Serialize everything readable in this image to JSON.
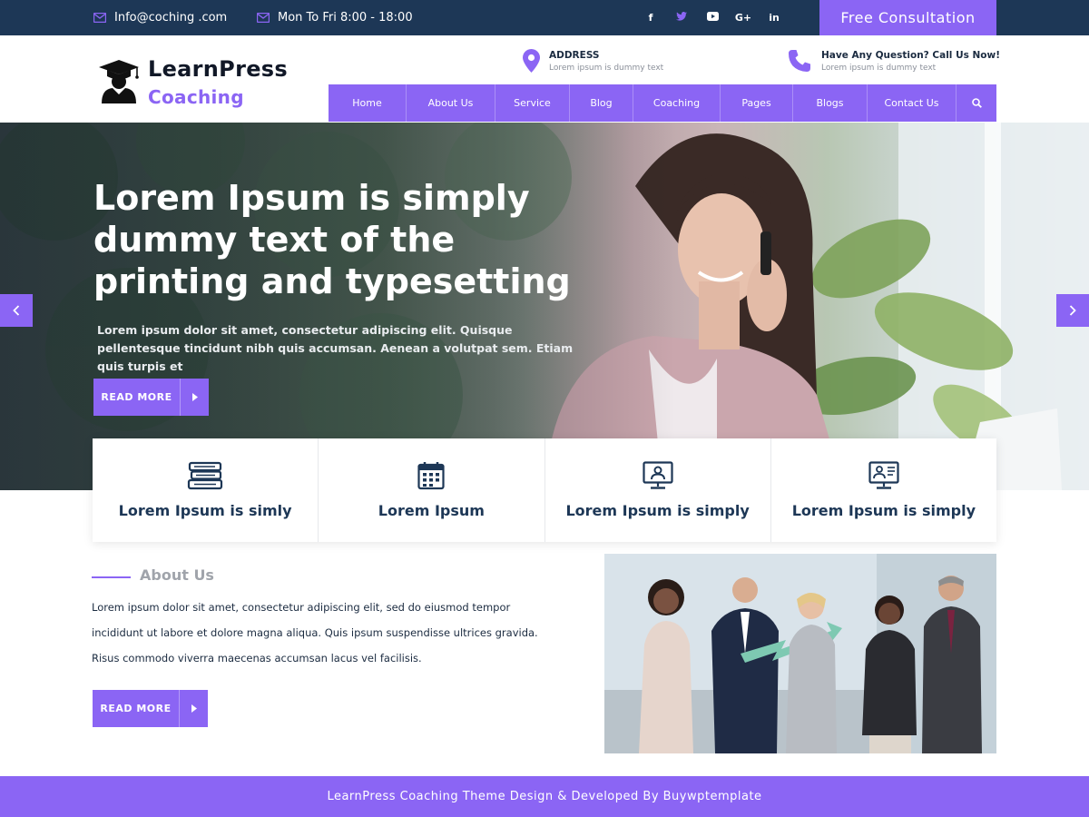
{
  "topbar": {
    "email": "Info@coching .com",
    "hours": "Mon To Fri  8:00 - 18:00",
    "social": [
      "f",
      "t",
      "yt",
      "G+",
      "in"
    ],
    "consult_label": "Free Consultation"
  },
  "logo": {
    "title": "LearnPress",
    "subtitle": "Coaching"
  },
  "contact": {
    "address_title": "ADDRESS",
    "address_text": "Lorem ipsum is dummy text",
    "phone_title": "Have Any Question? Call Us Now!",
    "phone_text": "Lorem ipsum is dummy text"
  },
  "nav": {
    "items": [
      "Home",
      "About Us",
      "Service",
      "Blog",
      "Coaching",
      "Pages",
      "Blogs",
      "Contact Us"
    ],
    "search_icon": "search-icon"
  },
  "hero": {
    "title": "Lorem Ipsum is simply dummy text of the printing and typesetting",
    "text": "Lorem ipsum dolor sit amet, consectetur adipiscing elit. Quisque pellentesque tincidunt nibh quis accumsan. Aenean a volutpat sem. Etiam quis turpis et",
    "button": "READ MORE"
  },
  "features": [
    {
      "title": "Lorem Ipsum is simly",
      "icon": "books-icon"
    },
    {
      "title": "Lorem Ipsum",
      "icon": "calendar-icon"
    },
    {
      "title": "Lorem Ipsum is simply",
      "icon": "monitor-user-icon"
    },
    {
      "title": "Lorem Ipsum is simply",
      "icon": "video-call-icon"
    }
  ],
  "about": {
    "heading": "About Us",
    "text": "Lorem ipsum dolor sit amet, consectetur adipiscing elit, sed do eiusmod tempor incididunt ut labore et dolore magna aliqua. Quis ipsum suspendisse ultrices gravida. Risus commodo viverra maecenas accumsan lacus vel facilisis.",
    "button": "READ MORE"
  },
  "footer": {
    "text": "LearnPress Coaching Theme Design & Developed By Buywptemplate"
  },
  "colors": {
    "accent": "#8b65f4",
    "dark": "#1d3756"
  }
}
